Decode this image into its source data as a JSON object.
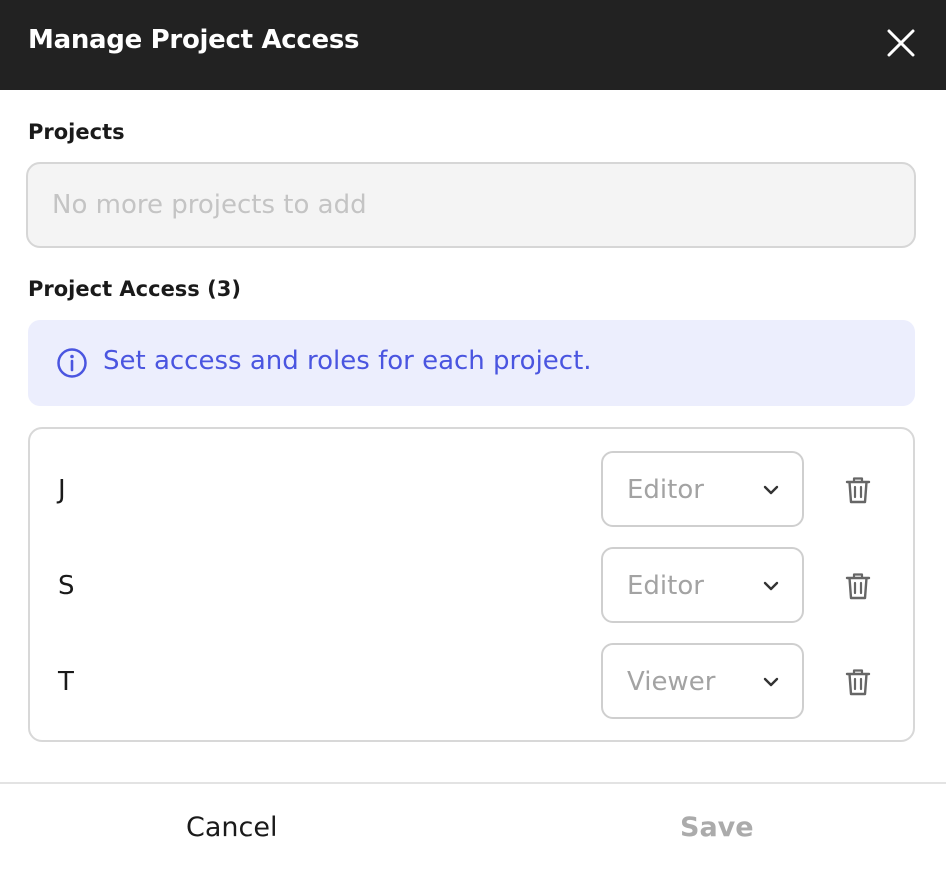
{
  "dialog": {
    "title": "Manage Project Access",
    "close_icon": "close-icon"
  },
  "projects": {
    "label": "Projects",
    "placeholder": "No more projects to add"
  },
  "access": {
    "label": "Project Access (3)",
    "info_text": "Set access and roles for each project.",
    "info_icon": "info-icon",
    "info_color": "#4a55e0",
    "info_bg": "#eceefd",
    "items": [
      {
        "name": "J",
        "role": "Editor"
      },
      {
        "name": "S",
        "role": "Editor"
      },
      {
        "name": "T",
        "role": "Viewer"
      }
    ]
  },
  "footer": {
    "cancel_label": "Cancel",
    "save_label": "Save"
  }
}
